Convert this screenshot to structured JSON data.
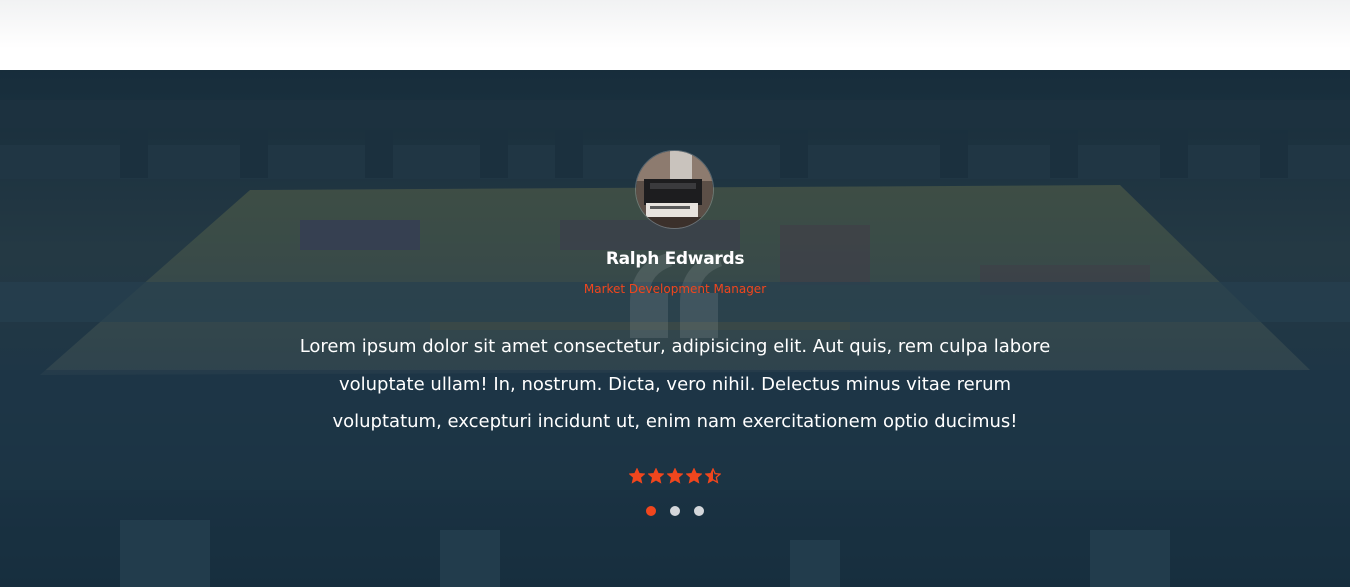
{
  "testimonial": {
    "name": "Ralph Edwards",
    "role": "Market Development Manager",
    "quote": "Lorem ipsum dolor sit amet consectetur, adipisicing elit. Aut quis, rem culpa labore voluptate ullam! In, nostrum. Dicta, vero nihil. Delectus minus vitae rerum voluptatum, excepturi incidunt ut, enim nam exercitationem optio ducimus!",
    "avatar_icon": "printing-press-photo",
    "quote_icon": "quote-mark-icon",
    "rating": 4.5,
    "rating_max": 5
  },
  "carousel": {
    "slide_count": 3,
    "active_index": 0
  },
  "colors": {
    "accent": "#f1461d",
    "overlay": "#122c3c",
    "text": "#ffffff",
    "dot_inactive": "#d4d7db"
  }
}
